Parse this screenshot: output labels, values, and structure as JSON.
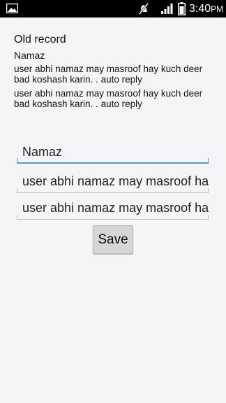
{
  "status_bar": {
    "time": "3:40",
    "ampm": "PM",
    "icons": [
      "gallery-icon",
      "mute-icon",
      "signal-icon",
      "battery-icon"
    ]
  },
  "old_record": {
    "title": "Old record",
    "name": "Namaz",
    "message_1": "user abhi namaz may masroof hay kuch deer bad koshash karin. . auto reply",
    "message_2": "user abhi namaz may masroof hay kuch deer bad koshash karin. . auto reply"
  },
  "form": {
    "name_value": "Namaz",
    "message_1_value": "user abhi namaz may masroof hay kuch deer bad koshash karin. . auto reply",
    "message_2_value": "user abhi namaz may masroof hay kuch deer bad koshash karin. . auto reply",
    "save_label": "Save"
  },
  "colors": {
    "status_bar": "#000000",
    "background": "#f5f5f7",
    "focused_underline": "#3ea6d6",
    "button": "#d6d6d6"
  }
}
